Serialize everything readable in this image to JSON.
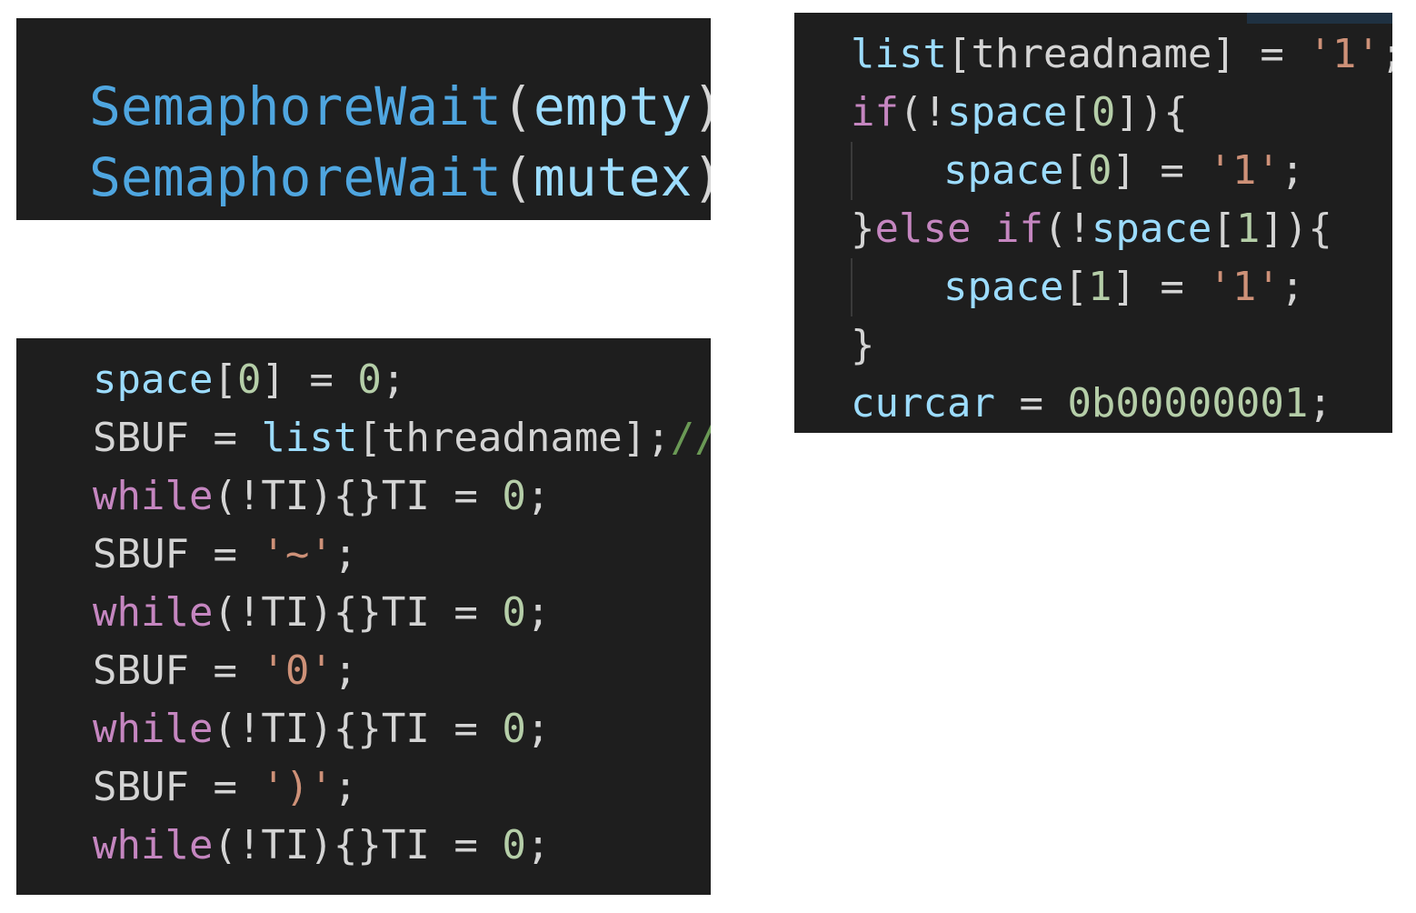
{
  "colors": {
    "panel_bg": "#1e1e1e",
    "function": "#4fa6e0",
    "variable": "#9cdcfe",
    "keyword": "#c586c0",
    "number": "#b5cea8",
    "string": "#ce9178",
    "comment": "#6a9955",
    "plain": "#d4d4d4"
  },
  "snippet_top_left": {
    "lines": [
      [
        {
          "t": "SemaphoreWait",
          "c": "fn"
        },
        {
          "t": "(",
          "c": "punc"
        },
        {
          "t": "empty",
          "c": "var"
        },
        {
          "t": ");",
          "c": "punc"
        },
        {
          "t": "/",
          "c": "cmt"
        }
      ],
      [
        {
          "t": "SemaphoreWait",
          "c": "fn"
        },
        {
          "t": "(",
          "c": "punc"
        },
        {
          "t": "mutex",
          "c": "var"
        },
        {
          "t": ");",
          "c": "punc"
        }
      ]
    ]
  },
  "snippet_bottom_left": {
    "lines": [
      [
        {
          "t": "space",
          "c": "var"
        },
        {
          "t": "[",
          "c": "punc"
        },
        {
          "t": "0",
          "c": "num"
        },
        {
          "t": "] = ",
          "c": "punc"
        },
        {
          "t": "0",
          "c": "num"
        },
        {
          "t": ";",
          "c": "punc"
        }
      ],
      [
        {
          "t": "SBUF = ",
          "c": "plain"
        },
        {
          "t": "list",
          "c": "var"
        },
        {
          "t": "[threadname];",
          "c": "plain"
        },
        {
          "t": "//t",
          "c": "cmt"
        }
      ],
      [
        {
          "t": "while",
          "c": "kw"
        },
        {
          "t": "(!TI){}TI = ",
          "c": "plain"
        },
        {
          "t": "0",
          "c": "num"
        },
        {
          "t": ";",
          "c": "punc"
        }
      ],
      [
        {
          "t": "SBUF = ",
          "c": "plain"
        },
        {
          "t": "'~'",
          "c": "str"
        },
        {
          "t": ";",
          "c": "punc"
        }
      ],
      [
        {
          "t": "while",
          "c": "kw"
        },
        {
          "t": "(!TI){}TI = ",
          "c": "plain"
        },
        {
          "t": "0",
          "c": "num"
        },
        {
          "t": ";",
          "c": "punc"
        }
      ],
      [
        {
          "t": "SBUF = ",
          "c": "plain"
        },
        {
          "t": "'0'",
          "c": "str"
        },
        {
          "t": ";",
          "c": "punc"
        }
      ],
      [
        {
          "t": "while",
          "c": "kw"
        },
        {
          "t": "(!TI){}TI = ",
          "c": "plain"
        },
        {
          "t": "0",
          "c": "num"
        },
        {
          "t": ";",
          "c": "punc"
        }
      ],
      [
        {
          "t": "SBUF = ",
          "c": "plain"
        },
        {
          "t": "')'",
          "c": "str"
        },
        {
          "t": ";",
          "c": "punc"
        }
      ],
      [
        {
          "t": "while",
          "c": "kw"
        },
        {
          "t": "(!TI){}TI = ",
          "c": "plain"
        },
        {
          "t": "0",
          "c": "num"
        },
        {
          "t": ";",
          "c": "punc"
        }
      ]
    ]
  },
  "snippet_right": {
    "lines": [
      [
        {
          "t": "list",
          "c": "var"
        },
        {
          "t": "[threadname] = ",
          "c": "plain"
        },
        {
          "t": "'1'",
          "c": "str"
        },
        {
          "t": ";",
          "c": "punc"
        }
      ],
      [
        {
          "t": "if",
          "c": "kw"
        },
        {
          "t": "(!",
          "c": "punc"
        },
        {
          "t": "space",
          "c": "var"
        },
        {
          "t": "[",
          "c": "punc"
        },
        {
          "t": "0",
          "c": "num"
        },
        {
          "t": "]){",
          "c": "punc"
        }
      ],
      [
        {
          "t": "space",
          "c": "var"
        },
        {
          "t": "[",
          "c": "punc"
        },
        {
          "t": "0",
          "c": "num"
        },
        {
          "t": "] = ",
          "c": "punc"
        },
        {
          "t": "'1'",
          "c": "str"
        },
        {
          "t": ";",
          "c": "punc"
        }
      ],
      [
        {
          "t": "}",
          "c": "punc"
        },
        {
          "t": "else if",
          "c": "kw"
        },
        {
          "t": "(!",
          "c": "punc"
        },
        {
          "t": "space",
          "c": "var"
        },
        {
          "t": "[",
          "c": "punc"
        },
        {
          "t": "1",
          "c": "num"
        },
        {
          "t": "]){",
          "c": "punc"
        }
      ],
      [
        {
          "t": "space",
          "c": "var"
        },
        {
          "t": "[",
          "c": "punc"
        },
        {
          "t": "1",
          "c": "num"
        },
        {
          "t": "] = ",
          "c": "punc"
        },
        {
          "t": "'1'",
          "c": "str"
        },
        {
          "t": ";",
          "c": "punc"
        }
      ],
      [
        {
          "t": "}",
          "c": "punc"
        }
      ],
      [
        {
          "t": "curcar",
          "c": "var"
        },
        {
          "t": " = ",
          "c": "punc"
        },
        {
          "t": "0b00000001",
          "c": "num"
        },
        {
          "t": ";",
          "c": "punc"
        }
      ]
    ]
  }
}
